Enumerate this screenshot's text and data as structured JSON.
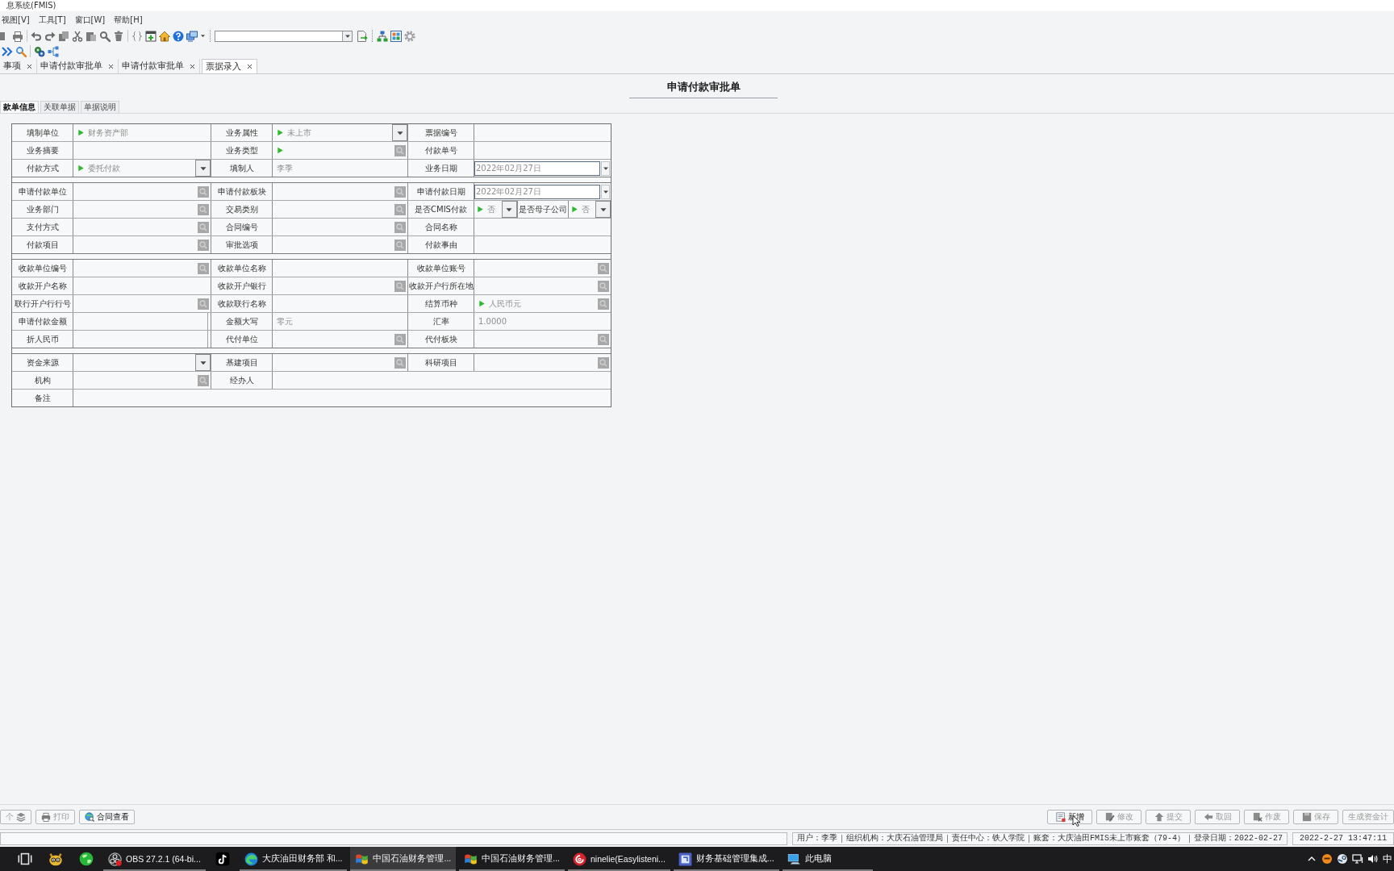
{
  "window": {
    "title": "息系统(FMIS)"
  },
  "menu": [
    "视图[V]",
    "工具[T]",
    "窗口[W]",
    "帮助[H]"
  ],
  "doc_tabs": [
    {
      "label": "事项",
      "selected": false
    },
    {
      "label": "申请付款审批单",
      "selected": false
    },
    {
      "label": "申请付款审批单",
      "selected": false
    },
    {
      "label": "票据录入",
      "selected": true
    }
  ],
  "form": {
    "title": "申请付款审批单",
    "tabs": [
      {
        "label": "款单信息",
        "selected": true
      },
      {
        "label": "关联单据",
        "selected": false
      },
      {
        "label": "单据说明",
        "selected": false
      }
    ],
    "groups": [
      {
        "rows": [
          {
            "cells": [
              {
                "kind": "label",
                "text": "填制单位"
              },
              {
                "kind": "text",
                "value": "财务资产部",
                "arrow": true
              },
              {
                "kind": "label",
                "text": "业务属性"
              },
              {
                "kind": "select",
                "value": "未上市",
                "arrow": true
              },
              {
                "kind": "label",
                "text": "票据编号"
              },
              {
                "kind": "text",
                "arrow": false
              }
            ]
          },
          {
            "cells": [
              {
                "kind": "label",
                "text": "业务摘要"
              },
              {
                "kind": "text",
                "arrow": false
              },
              {
                "kind": "label",
                "text": "业务类型"
              },
              {
                "kind": "lookup",
                "arrow": true
              },
              {
                "kind": "label",
                "text": "付款单号"
              },
              {
                "kind": "text",
                "arrow": false
              }
            ]
          },
          {
            "cells": [
              {
                "kind": "label",
                "text": "付款方式"
              },
              {
                "kind": "select",
                "value": "委托付款",
                "arrow": true
              },
              {
                "kind": "label",
                "text": "填制人"
              },
              {
                "kind": "text",
                "value": "李季",
                "arrow": false
              },
              {
                "kind": "label",
                "text": "业务日期"
              },
              {
                "kind": "date",
                "value": "2022年02月27日",
                "arrow": false
              }
            ]
          }
        ]
      },
      {
        "rows": [
          {
            "cells": [
              {
                "kind": "label",
                "text": "申请付款单位"
              },
              {
                "kind": "lookup",
                "arrow": false
              },
              {
                "kind": "label",
                "text": "申请付款板块"
              },
              {
                "kind": "lookup",
                "arrow": false
              },
              {
                "kind": "label",
                "text": "申请付款日期"
              },
              {
                "kind": "date",
                "value": "2022年02月27日",
                "arrow": false
              }
            ]
          },
          {
            "cells": [
              {
                "kind": "label",
                "text": "业务部门"
              },
              {
                "kind": "lookup",
                "arrow": false
              },
              {
                "kind": "label",
                "text": "交易类别"
              },
              {
                "kind": "lookup",
                "arrow": false
              },
              {
                "kind": "label",
                "text": "是否CMIS付款"
              },
              {
                "kind": "select",
                "value": "否",
                "arrow": true
              },
              {
                "kind": "label",
                "text": "是否母子公司"
              },
              {
                "kind": "select",
                "value": "否",
                "arrow": true
              }
            ]
          },
          {
            "cells": [
              {
                "kind": "label",
                "text": "支付方式"
              },
              {
                "kind": "lookup",
                "arrow": false
              },
              {
                "kind": "label",
                "text": "合同编号"
              },
              {
                "kind": "lookup",
                "arrow": false
              },
              {
                "kind": "label",
                "text": "合同名称"
              },
              {
                "kind": "text",
                "arrow": false
              }
            ]
          },
          {
            "cells": [
              {
                "kind": "label",
                "text": "付款项目"
              },
              {
                "kind": "lookup",
                "arrow": false
              },
              {
                "kind": "label",
                "text": "审批选项"
              },
              {
                "kind": "lookup",
                "arrow": false
              },
              {
                "kind": "label",
                "text": "付款事由"
              },
              {
                "kind": "text",
                "arrow": false
              }
            ]
          }
        ]
      },
      {
        "rows": [
          {
            "cells": [
              {
                "kind": "label",
                "text": "收款单位编号"
              },
              {
                "kind": "lookup",
                "arrow": false
              },
              {
                "kind": "label",
                "text": "收款单位名称"
              },
              {
                "kind": "text",
                "arrow": false
              },
              {
                "kind": "label",
                "text": "收款单位账号"
              },
              {
                "kind": "lookup",
                "arrow": false
              }
            ]
          },
          {
            "cells": [
              {
                "kind": "label",
                "text": "收款开户名称"
              },
              {
                "kind": "text",
                "arrow": false
              },
              {
                "kind": "label",
                "text": "收款开户银行"
              },
              {
                "kind": "lookup",
                "arrow": false
              },
              {
                "kind": "label",
                "text": "收款开户行所在地"
              },
              {
                "kind": "lookup",
                "arrow": false
              }
            ]
          },
          {
            "cells": [
              {
                "kind": "label",
                "text": "联行开户行行号"
              },
              {
                "kind": "lookup",
                "arrow": false
              },
              {
                "kind": "label",
                "text": "收款联行名称"
              },
              {
                "kind": "text",
                "arrow": false
              },
              {
                "kind": "label",
                "text": "结算币种"
              },
              {
                "kind": "lookup",
                "value": "人民币元",
                "arrow": true
              }
            ]
          },
          {
            "cells": [
              {
                "kind": "label",
                "text": "申请付款金额"
              },
              {
                "kind": "input",
                "arrow": false
              },
              {
                "kind": "label",
                "text": "金额大写"
              },
              {
                "kind": "text",
                "value": "零元",
                "arrow": false
              },
              {
                "kind": "label",
                "text": "汇率"
              },
              {
                "kind": "text",
                "value": "1.0000",
                "arrow": false
              }
            ]
          },
          {
            "cells": [
              {
                "kind": "label",
                "text": "折人民币"
              },
              {
                "kind": "input",
                "arrow": false
              },
              {
                "kind": "label",
                "text": "代付单位"
              },
              {
                "kind": "lookup",
                "arrow": false
              },
              {
                "kind": "label",
                "text": "代付板块"
              },
              {
                "kind": "lookup",
                "arrow": false
              }
            ]
          }
        ]
      },
      {
        "rows": [
          {
            "cells": [
              {
                "kind": "label",
                "text": "资金来源"
              },
              {
                "kind": "select",
                "arrow": false
              },
              {
                "kind": "label",
                "text": "基建项目"
              },
              {
                "kind": "lookup",
                "arrow": false
              },
              {
                "kind": "label",
                "text": "科研项目"
              },
              {
                "kind": "lookup",
                "arrow": false
              }
            ]
          },
          {
            "cells": [
              {
                "kind": "label",
                "text": "机构"
              },
              {
                "kind": "lookup",
                "arrow": false
              },
              {
                "kind": "label",
                "text": "经办人"
              },
              {
                "kind": "text",
                "arrow": false
              }
            ]
          },
          {
            "cells": [
              {
                "kind": "label",
                "text": "备注"
              },
              {
                "kind": "text",
                "arrow": false
              }
            ]
          }
        ]
      }
    ]
  },
  "bottom_bar": {
    "left": [
      {
        "label": "个",
        "disabled": true
      },
      {
        "label": "打印",
        "disabled": true
      },
      {
        "label": "合同查看",
        "disabled": false
      }
    ],
    "right": [
      {
        "label": "新增",
        "disabled": false
      },
      {
        "label": "修改",
        "disabled": true
      },
      {
        "label": "提交",
        "disabled": true
      },
      {
        "label": "取回",
        "disabled": true
      },
      {
        "label": "作废",
        "disabled": true
      },
      {
        "label": "保存",
        "disabled": true
      },
      {
        "label": "生成资金计",
        "disabled": true
      }
    ]
  },
  "status_bar": {
    "fields": [
      "用户：李季",
      "组织机构：大庆石油管理局",
      "责任中心：铁人学院",
      "账套：大庆油田FMIS未上市账套（79-4）",
      "登录日期：2022-02-27"
    ],
    "time": "2022-2-27 13:47:11"
  },
  "taskbar": {
    "items": [
      {
        "kind": "icon",
        "selected": false
      },
      {
        "kind": "icon",
        "selected": false
      },
      {
        "kind": "icon",
        "selected": false
      },
      {
        "kind": "window",
        "label": "OBS 27.2.1 (64-bi...",
        "selected": false
      },
      {
        "kind": "icon",
        "selected": false
      },
      {
        "kind": "window",
        "label": "大庆油田财务部 和...",
        "selected": false
      },
      {
        "kind": "window",
        "label": "中国石油财务管理...",
        "selected": true
      },
      {
        "kind": "window",
        "label": "中国石油财务管理...",
        "selected": false
      },
      {
        "kind": "window",
        "label": "ninelie(Easylisteni...",
        "selected": false
      },
      {
        "kind": "window",
        "label": "财务基础管理集成...",
        "selected": false
      },
      {
        "kind": "window",
        "label": "此电脑",
        "selected": false
      }
    ],
    "input_method": "中"
  }
}
